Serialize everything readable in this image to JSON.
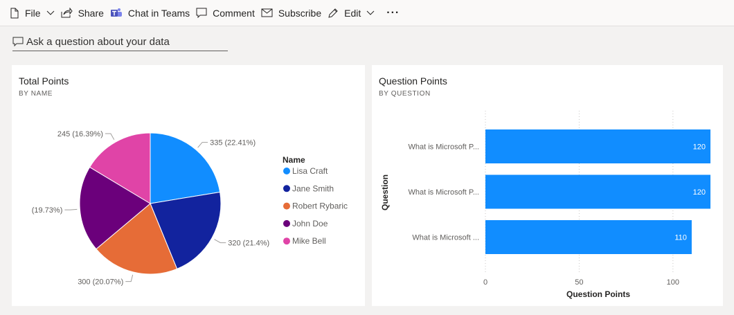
{
  "toolbar": {
    "file": "File",
    "share": "Share",
    "chat": "Chat in Teams",
    "comment": "Comment",
    "subscribe": "Subscribe",
    "edit": "Edit",
    "more": "···"
  },
  "qa": {
    "placeholder": "Ask a question about your data"
  },
  "colors": {
    "lisa": "#118dff",
    "jane": "#12239e",
    "robert": "#e66c37",
    "john": "#6b007b",
    "mike": "#e044a7",
    "bar": "#118dff"
  },
  "chart_data": [
    {
      "type": "pie",
      "title": "Total Points",
      "subtitle": "BY NAME",
      "legend_title": "Name",
      "legend_position": "right",
      "slices": [
        {
          "name": "Lisa Craft",
          "value": 335,
          "label": "335 (22.41%)"
        },
        {
          "name": "Jane Smith",
          "value": 320,
          "label": "320 (21.4%)"
        },
        {
          "name": "Robert Rybaric",
          "value": 300,
          "label": "300 (20.07%)"
        },
        {
          "name": "John Doe",
          "value": 295,
          "label": "(19.73%)"
        },
        {
          "name": "Mike Bell",
          "value": 245,
          "label": "245 (16.39%)"
        }
      ]
    },
    {
      "type": "bar",
      "orientation": "horizontal",
      "title": "Question Points",
      "subtitle": "BY QUESTION",
      "categories": [
        "What is Microsoft P...",
        "What is Microsoft P...",
        "What is Microsoft ..."
      ],
      "values": [
        120,
        120,
        110
      ],
      "xlabel": "Question Points",
      "ylabel": "Question",
      "xlim": [
        0,
        120
      ],
      "xticks": [
        0,
        50,
        100
      ],
      "grid": true
    }
  ]
}
